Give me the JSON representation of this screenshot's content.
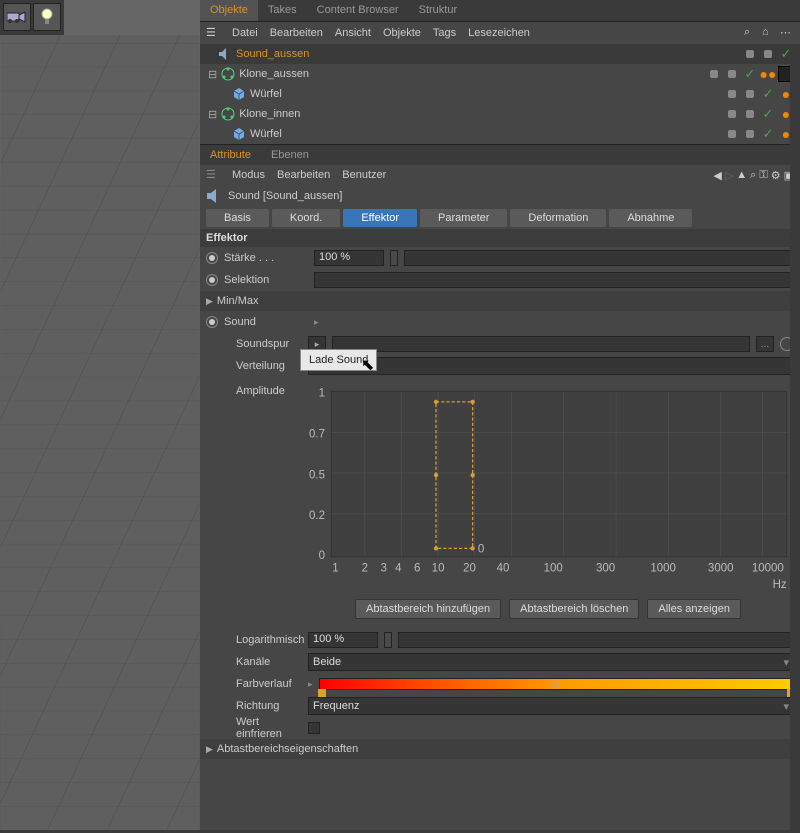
{
  "tabs_top": {
    "objekte": "Objekte",
    "takes": "Takes",
    "content_browser": "Content Browser",
    "struktur": "Struktur"
  },
  "menu_top": {
    "datei": "Datei",
    "bearbeiten": "Bearbeiten",
    "ansicht": "Ansicht",
    "objekte": "Objekte",
    "tags": "Tags",
    "lesezeichen": "Lesezeichen"
  },
  "tree": [
    {
      "name": "Sound_aussen",
      "selected": true
    },
    {
      "name": "Klone_aussen"
    },
    {
      "name": "Würfel"
    },
    {
      "name": "Klone_innen"
    },
    {
      "name": "Würfel"
    }
  ],
  "attr_tabs": {
    "attribute": "Attribute",
    "ebenen": "Ebenen"
  },
  "attr_menu": {
    "modus": "Modus",
    "bearbeiten": "Bearbeiten",
    "benutzer": "Benutzer"
  },
  "obj_title": "Sound [Sound_aussen]",
  "sub_tabs": {
    "basis": "Basis",
    "koord": "Koord.",
    "effektor": "Effektor",
    "parameter": "Parameter",
    "deformation": "Deformation",
    "abnahme": "Abnahme"
  },
  "section_title": "Effektor",
  "fields": {
    "staerke_label": "Stärke . . .",
    "staerke_value": "100 %",
    "selektion": "Selektion",
    "minmax": "Min/Max",
    "sound": "Sound",
    "soundspur": "Soundspur",
    "verteilung": "Verteilung",
    "amplitude": "Amplitude",
    "logarithmisch": "Logarithmisch",
    "log_value": "100 %",
    "kanaele": "Kanäle",
    "kanaele_value": "Beide",
    "farbverlauf": "Farbverlauf",
    "richtung": "Richtung",
    "richtung_value": "Frequenz",
    "wert_einfrieren": "Wert einfrieren",
    "abtast": "Abtastbereichseigenschaften"
  },
  "popup": "Lade Sound",
  "buttons": {
    "add": "Abtastbereich hinzufügen",
    "del": "Abtastbereich löschen",
    "all": "Alles anzeigen"
  },
  "chart_data": {
    "type": "area",
    "xlabel": "Hz",
    "ylabel": "",
    "ylim": [
      0.0,
      1.0
    ],
    "yticks": [
      0.0,
      0.2,
      0.5,
      0.7,
      1.0
    ],
    "xticks": [
      1,
      2,
      3,
      4,
      6,
      10,
      20,
      40,
      100,
      300,
      1000,
      3000,
      10000
    ],
    "selection_box": {
      "x0": 10,
      "x1": 20,
      "y0": 0.0,
      "y1": 1.0
    },
    "title": ""
  }
}
